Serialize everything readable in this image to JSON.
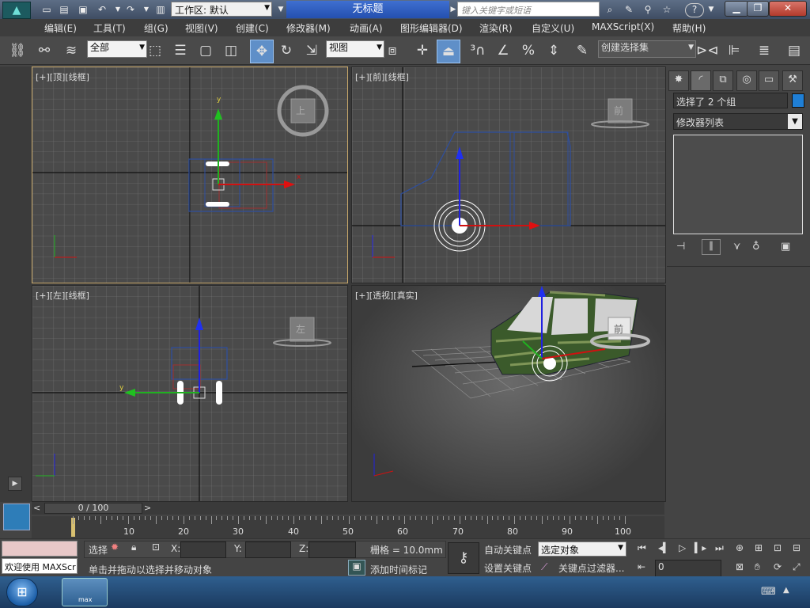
{
  "app": {
    "title": "无标题",
    "workspace_label": "工作区: 默认",
    "search_placeholder": "键入关键字或短语"
  },
  "menu": [
    "编辑(E)",
    "工具(T)",
    "组(G)",
    "视图(V)",
    "创建(C)",
    "修改器(M)",
    "动画(A)",
    "图形编辑器(D)",
    "渲染(R)",
    "自定义(U)",
    "MAXScript(X)",
    "帮助(H)"
  ],
  "toolbar": {
    "selection_filter": "全部",
    "ref_coord": "视图",
    "named_selection": "创建选择集"
  },
  "viewports": {
    "top": {
      "label": "[+][顶][线框]",
      "cube": "上"
    },
    "front": {
      "label": "[+][前][线框]",
      "cube": "前"
    },
    "left": {
      "label": "[+][左][线框]",
      "cube": "左"
    },
    "perspective": {
      "label": "[+][透视][真实]",
      "cube": "前"
    }
  },
  "command_panel": {
    "selection_name": "选择了 2 个组",
    "modifier_list": "修改器列表",
    "accent_color": "#1f7fd6"
  },
  "timeline": {
    "frame_display": "0 / 100",
    "ticks": [
      "10",
      "20",
      "30",
      "40",
      "50",
      "60",
      "70",
      "80",
      "90",
      "100"
    ]
  },
  "status": {
    "maxscript_welcome": "欢迎使用 MAXScr",
    "select_label": "选择",
    "x_label": "X:",
    "y_label": "Y:",
    "z_label": "Z:",
    "grid_text": "栅格 = 10.0mm",
    "prompt": "单击并拖动以选择并移动对象",
    "add_time_tag": "添加时间标记",
    "auto_key": "自动关键点",
    "set_key": "设置关键点",
    "key_mode": "选定对象",
    "key_filters": "关键点过滤器...",
    "frame_value": "0"
  },
  "taskbar": {
    "app_badge": "max"
  }
}
